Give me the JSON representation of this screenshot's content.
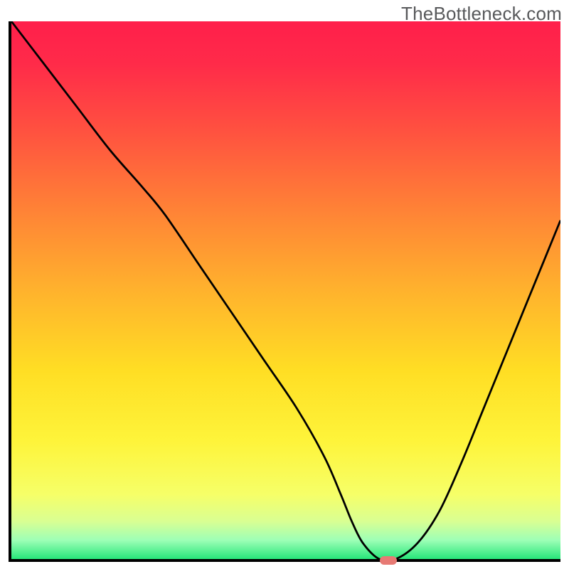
{
  "watermark": "TheBottleneck.com",
  "colors": {
    "axis": "#000000",
    "curve": "#000000",
    "marker": "#e77a74",
    "watermark_text": "#58595b"
  },
  "chart_data": {
    "type": "line",
    "title": "",
    "xlabel": "",
    "ylabel": "",
    "xlim": [
      0,
      100
    ],
    "ylim": [
      0,
      100
    ],
    "gradient_stops": [
      {
        "pos": 0.0,
        "color": "#ff1f4b"
      },
      {
        "pos": 0.08,
        "color": "#ff2b49"
      },
      {
        "pos": 0.2,
        "color": "#ff5040"
      },
      {
        "pos": 0.35,
        "color": "#ff8236"
      },
      {
        "pos": 0.5,
        "color": "#ffb22d"
      },
      {
        "pos": 0.65,
        "color": "#ffde24"
      },
      {
        "pos": 0.78,
        "color": "#fef43a"
      },
      {
        "pos": 0.88,
        "color": "#f6ff68"
      },
      {
        "pos": 0.93,
        "color": "#d9ff93"
      },
      {
        "pos": 0.965,
        "color": "#9dffb6"
      },
      {
        "pos": 1.0,
        "color": "#27e67a"
      }
    ],
    "series": [
      {
        "name": "bottleneck-curve",
        "x": [
          0,
          6,
          12,
          18,
          24,
          28,
          34,
          40,
          46,
          52,
          57,
          60,
          62,
          64,
          67,
          70,
          74,
          78,
          82,
          86,
          90,
          94,
          98,
          100
        ],
        "y": [
          100,
          92,
          84,
          76,
          69,
          64,
          55,
          46,
          37,
          28,
          19,
          12,
          7,
          3,
          0,
          0,
          3,
          9,
          18,
          28,
          38,
          48,
          58,
          63
        ]
      }
    ],
    "marker": {
      "x": 68.3,
      "y": 0,
      "w": 3.2,
      "h": 1.6
    },
    "annotations": []
  }
}
